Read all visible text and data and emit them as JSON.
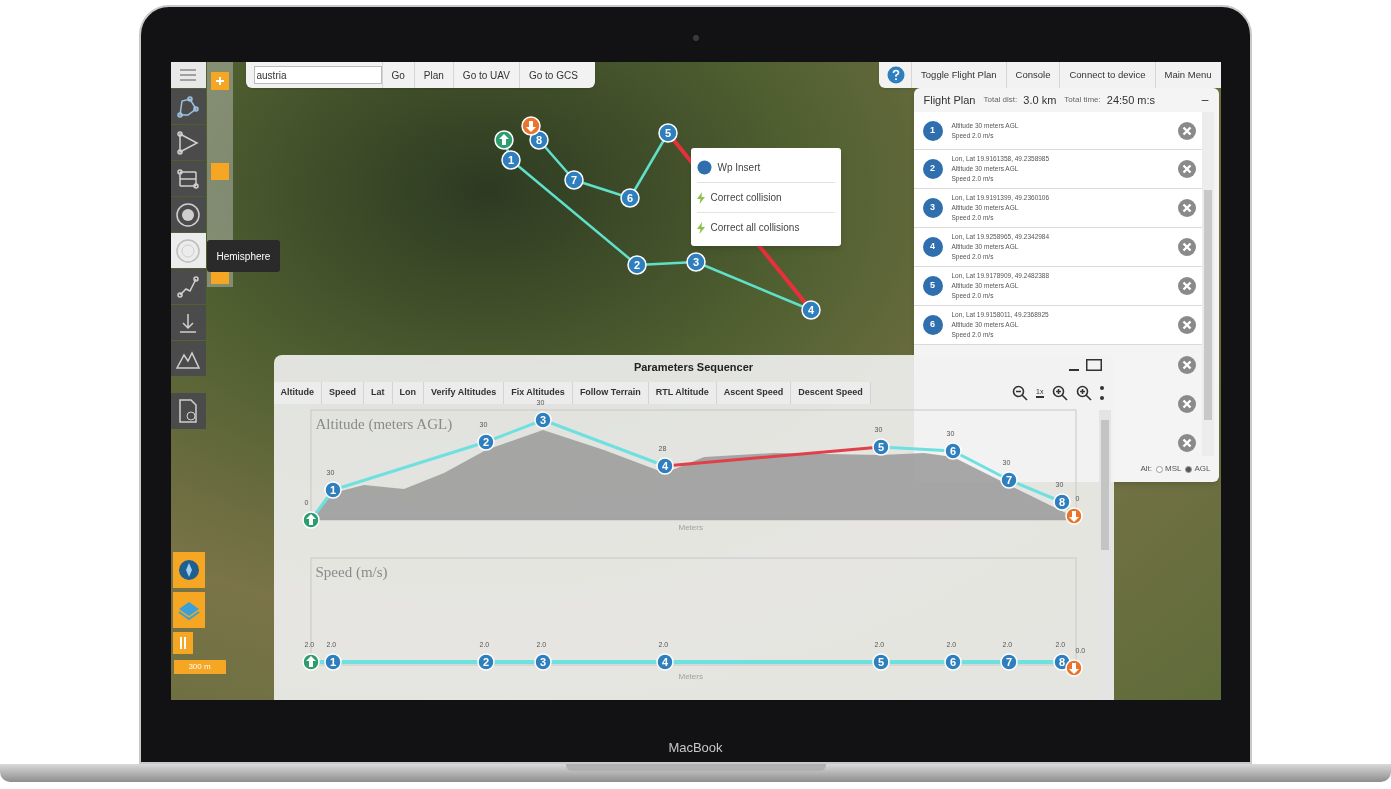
{
  "laptop": {
    "brand": "MacBook"
  },
  "toolbar": {
    "tools": [
      {
        "kind": "polygon",
        "selected": false
      },
      {
        "kind": "triangle",
        "selected": false
      },
      {
        "kind": "grid",
        "selected": false
      },
      {
        "kind": "circle",
        "selected": false
      },
      {
        "kind": "hemisphere",
        "selected": true
      },
      {
        "kind": "path",
        "selected": false
      },
      {
        "kind": "descend",
        "selected": false
      },
      {
        "kind": "terrain",
        "selected": false
      }
    ],
    "tooltip": "Hemisphere"
  },
  "zoom": {
    "level": 0.55
  },
  "scale": "300 m",
  "search": {
    "value": "austria",
    "buttons": [
      "Go",
      "Plan",
      "Go to UAV",
      "Go to GCS"
    ]
  },
  "top_menu": [
    "Toggle Flight Plan",
    "Console",
    "Connect to device",
    "Main Menu"
  ],
  "map": {
    "waypoints": [
      {
        "kind": "takeoff"
      },
      {
        "kind": "waypoint",
        "label": "1"
      },
      {
        "kind": "waypoint",
        "label": "2"
      },
      {
        "kind": "waypoint",
        "label": "3"
      },
      {
        "kind": "waypoint",
        "label": "4"
      },
      {
        "kind": "waypoint",
        "label": "5"
      },
      {
        "kind": "waypoint",
        "label": "6"
      },
      {
        "kind": "waypoint",
        "label": "7"
      },
      {
        "kind": "waypoint",
        "label": "8"
      },
      {
        "kind": "land"
      }
    ],
    "segments": [
      {
        "collision": false
      },
      {
        "collision": false
      },
      {
        "collision": false
      },
      {
        "collision": false
      },
      {
        "collision": true
      },
      {
        "collision": false
      },
      {
        "collision": false
      },
      {
        "collision": false
      },
      {
        "collision": false
      }
    ]
  },
  "context_menu": [
    {
      "kind": "insert",
      "label": "Wp Insert"
    },
    {
      "kind": "fix",
      "label": "Correct collision"
    },
    {
      "kind": "fix",
      "label": "Correct all collisions"
    }
  ],
  "flight_plan": {
    "title": "Flight Plan",
    "dist_label": "Total dist:",
    "dist": "3.0 km",
    "time_label": "Total time:",
    "time": "24:50 m:s",
    "collapse": "–",
    "rows": [
      {
        "label": "1",
        "lines": [
          "Altitude 30 meters AGL",
          "Speed 2.0 m/s"
        ]
      },
      {
        "label": "2",
        "lines": [
          "Lon, Lat 19.9161358, 49.2358985",
          "Altitude 30 meters AGL",
          "Speed 2.0 m/s"
        ]
      },
      {
        "label": "3",
        "lines": [
          "Lon, Lat 19.9191399, 49.2360106",
          "Altitude 30 meters AGL",
          "Speed 2.0 m/s"
        ]
      },
      {
        "label": "4",
        "lines": [
          "Lon, Lat 19.9258965, 49.2342984",
          "Altitude 30 meters AGL",
          "Speed 2.0 m/s"
        ]
      },
      {
        "label": "5",
        "lines": [
          "Lon, Lat 19.9178909, 49.2482388",
          "Altitude 30 meters AGL",
          "Speed 2.0 m/s"
        ]
      },
      {
        "label": "6",
        "lines": [
          "Lon, Lat 19.9158011, 49.2368925",
          "Altitude 30 meters AGL",
          "Speed 2.0 m/s"
        ]
      },
      {},
      {},
      {}
    ],
    "alt_label": "Alt:",
    "alt_modes": [
      {
        "label": "MSL",
        "selected": false
      },
      {
        "label": "AGL",
        "selected": true
      }
    ]
  },
  "sequencer": {
    "title": "Parameters Sequencer",
    "reset_label": "1x",
    "tabs": [
      "Altitude",
      "Speed",
      "Lat",
      "Lon",
      "Verify Altitudes",
      "Fix Altitudes",
      "Follow Terrain",
      "RTL Altitude",
      "Ascent Speed",
      "Descent Speed"
    ],
    "charts": [
      {
        "kind": "altitude",
        "title": "Altitude (meters AGL)",
        "xlabel": "Meters",
        "values": [
          "0",
          "30",
          "30",
          "30",
          "28",
          "30",
          "30",
          "30",
          "30",
          "0"
        ],
        "markers": [
          {
            "kind": "takeoff"
          },
          {
            "kind": "waypoint",
            "label": "1"
          },
          {
            "kind": "waypoint",
            "label": "2"
          },
          {
            "kind": "waypoint",
            "label": "3"
          },
          {
            "kind": "waypoint",
            "label": "4"
          },
          {
            "kind": "waypoint",
            "label": "5"
          },
          {
            "kind": "waypoint",
            "label": "6"
          },
          {
            "kind": "waypoint",
            "label": "7"
          },
          {
            "kind": "waypoint",
            "label": "8"
          },
          {
            "kind": "land"
          }
        ]
      },
      {
        "kind": "speed",
        "title": "Speed (m/s)",
        "xlabel": "Meters",
        "values": [
          "2.0",
          "2.0",
          "2.0",
          "2.0",
          "2.0",
          "2.0",
          "2.0",
          "2.0",
          "2.0",
          "0.0"
        ],
        "markers": [
          {
            "kind": "takeoff"
          },
          {
            "kind": "waypoint",
            "label": "1"
          },
          {
            "kind": "waypoint",
            "label": "2"
          },
          {
            "kind": "waypoint",
            "label": "3"
          },
          {
            "kind": "waypoint",
            "label": "4"
          },
          {
            "kind": "waypoint",
            "label": "5"
          },
          {
            "kind": "waypoint",
            "label": "6"
          },
          {
            "kind": "waypoint",
            "label": "7"
          },
          {
            "kind": "waypoint",
            "label": "8"
          },
          {
            "kind": "land"
          }
        ]
      }
    ]
  }
}
